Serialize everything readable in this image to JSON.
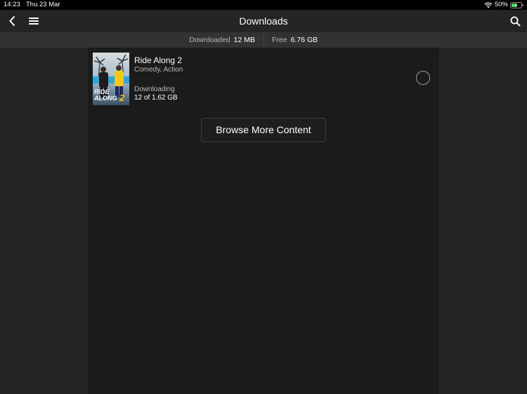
{
  "status_bar": {
    "time": "14:23",
    "date": "Thu 23 Mar",
    "battery_percent": "50%",
    "icons": [
      "wifi-icon",
      "battery-charging-icon"
    ]
  },
  "nav": {
    "title": "Downloads",
    "icons": [
      "back-chevron-icon",
      "menu-icon",
      "search-icon"
    ]
  },
  "storage": {
    "downloaded_label": "Downloaded",
    "downloaded_value": "12 MB",
    "free_label": "Free",
    "free_value": "6.76 GB"
  },
  "downloads": [
    {
      "title": "Ride Along 2",
      "genres": "Comedy, Action",
      "status": "Downloading",
      "progress": "12 of 1.62 GB",
      "poster_text": "RIDE ALONG 2"
    }
  ],
  "browse_button_label": "Browse More Content",
  "colors": {
    "background": "#242424",
    "panel": "#1b1b1b",
    "storage_bar": "#323232",
    "status_bar": "#000000",
    "battery_fill": "#4cd964"
  }
}
